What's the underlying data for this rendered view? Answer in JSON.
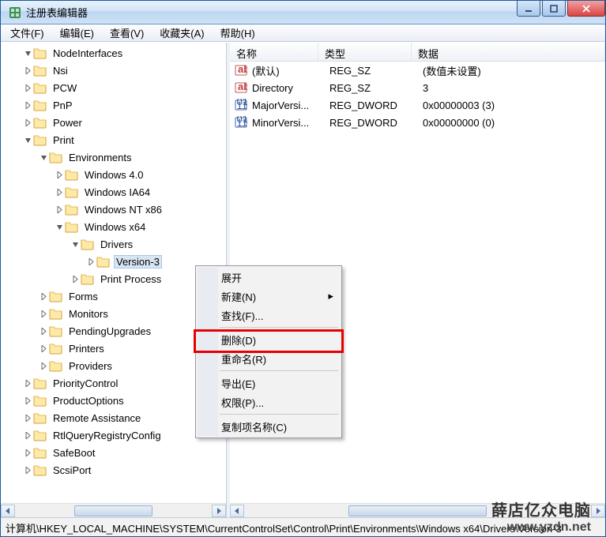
{
  "window": {
    "title": "注册表编辑器"
  },
  "menu": {
    "file": "文件(F)",
    "edit": "编辑(E)",
    "view": "查看(V)",
    "fav": "收藏夹(A)",
    "help": "帮助(H)"
  },
  "tree": [
    {
      "indent": 28,
      "twist": "open",
      "label": "NodeInterfaces"
    },
    {
      "indent": 28,
      "twist": "closed",
      "label": "Nsi"
    },
    {
      "indent": 28,
      "twist": "closed",
      "label": "PCW"
    },
    {
      "indent": 28,
      "twist": "closed",
      "label": "PnP"
    },
    {
      "indent": 28,
      "twist": "closed",
      "label": "Power"
    },
    {
      "indent": 28,
      "twist": "open",
      "label": "Print"
    },
    {
      "indent": 48,
      "twist": "open",
      "label": "Environments"
    },
    {
      "indent": 68,
      "twist": "closed",
      "label": "Windows 4.0"
    },
    {
      "indent": 68,
      "twist": "closed",
      "label": "Windows IA64"
    },
    {
      "indent": 68,
      "twist": "closed",
      "label": "Windows NT x86"
    },
    {
      "indent": 68,
      "twist": "open",
      "label": "Windows x64"
    },
    {
      "indent": 88,
      "twist": "open",
      "label": "Drivers"
    },
    {
      "indent": 108,
      "twist": "closed",
      "label": "Version-3",
      "selected": true
    },
    {
      "indent": 88,
      "twist": "closed",
      "label": "Print Process"
    },
    {
      "indent": 48,
      "twist": "closed",
      "label": "Forms"
    },
    {
      "indent": 48,
      "twist": "closed",
      "label": "Monitors"
    },
    {
      "indent": 48,
      "twist": "closed",
      "label": "PendingUpgrades"
    },
    {
      "indent": 48,
      "twist": "closed",
      "label": "Printers"
    },
    {
      "indent": 48,
      "twist": "closed",
      "label": "Providers"
    },
    {
      "indent": 28,
      "twist": "closed",
      "label": "PriorityControl"
    },
    {
      "indent": 28,
      "twist": "closed",
      "label": "ProductOptions"
    },
    {
      "indent": 28,
      "twist": "closed",
      "label": "Remote Assistance"
    },
    {
      "indent": 28,
      "twist": "closed",
      "label": "RtlQueryRegistryConfig"
    },
    {
      "indent": 28,
      "twist": "closed",
      "label": "SafeBoot"
    },
    {
      "indent": 28,
      "twist": "closed",
      "label": "ScsiPort"
    }
  ],
  "cols": {
    "name": "名称",
    "type": "类型",
    "data": "数据"
  },
  "values": [
    {
      "icon": "sz",
      "name": "(默认)",
      "type": "REG_SZ",
      "data": "(数值未设置)"
    },
    {
      "icon": "sz",
      "name": "Directory",
      "type": "REG_SZ",
      "data": "3"
    },
    {
      "icon": "dw",
      "name": "MajorVersi...",
      "type": "REG_DWORD",
      "data": "0x00000003 (3)"
    },
    {
      "icon": "dw",
      "name": "MinorVersi...",
      "type": "REG_DWORD",
      "data": "0x00000000 (0)"
    }
  ],
  "context": {
    "expand": "展开",
    "new": "新建(N)",
    "find": "查找(F)...",
    "delete": "删除(D)",
    "rename": "重命名(R)",
    "export": "导出(E)",
    "perm": "权限(P)...",
    "copyname": "复制项名称(C)"
  },
  "status": "计算机\\HKEY_LOCAL_MACHINE\\SYSTEM\\CurrentControlSet\\Control\\Print\\Environments\\Windows x64\\Drivers\\Version-3",
  "watermark1": "薛店亿众电脑",
  "watermark2": "www.yzdn.net"
}
